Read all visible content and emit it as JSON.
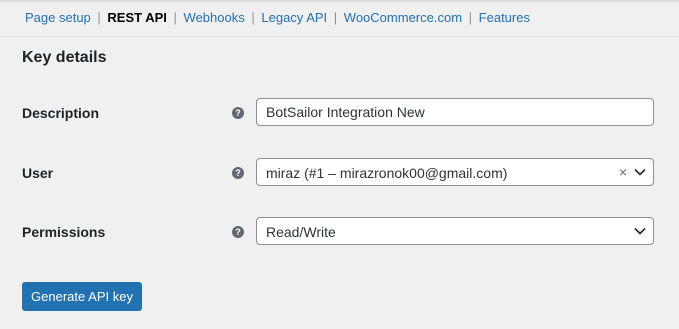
{
  "subnav": {
    "items": [
      {
        "label": "Page setup",
        "current": false
      },
      {
        "label": "REST API",
        "current": true
      },
      {
        "label": "Webhooks",
        "current": false
      },
      {
        "label": "Legacy API",
        "current": false
      },
      {
        "label": "WooCommerce.com",
        "current": false
      },
      {
        "label": "Features",
        "current": false
      }
    ],
    "separator": "|"
  },
  "section_title": "Key details",
  "form": {
    "description": {
      "label": "Description",
      "value": "BotSailor Integration New",
      "help": "?"
    },
    "user": {
      "label": "User",
      "value": "miraz (#1 – mirazronok00@gmail.com)",
      "clear": "×",
      "help": "?"
    },
    "permissions": {
      "label": "Permissions",
      "value": "Read/Write",
      "help": "?"
    }
  },
  "generate_button": "Generate API key",
  "colors": {
    "link": "#2271b1",
    "button_bg": "#2271b1",
    "page_bg": "#f0f0f1"
  }
}
